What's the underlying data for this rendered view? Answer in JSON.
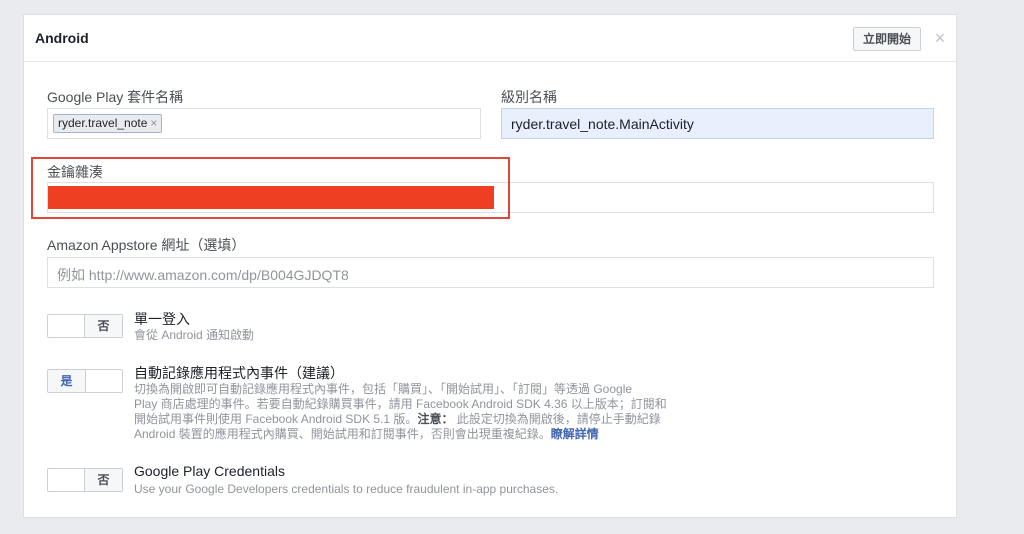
{
  "panel": {
    "title": "Android",
    "start_button": "立即開始",
    "close_glyph": "×"
  },
  "package_name": {
    "label": "Google Play 套件名稱",
    "token": "ryder.travel_note",
    "token_remove": "×"
  },
  "class_name": {
    "label": "級別名稱",
    "value": "ryder.travel_note.MainActivity"
  },
  "key_hash": {
    "label": "金鑰雜湊"
  },
  "amazon": {
    "label": "Amazon Appstore 網址（選填）",
    "placeholder": "例如 http://www.amazon.com/dp/B004GJDQT8"
  },
  "single_sign_on": {
    "toggle_label": "否",
    "title": "單一登入",
    "desc": "會從 Android 通知啟動"
  },
  "auto_log": {
    "toggle_label": "是",
    "title": "自動記錄應用程式內事件（建議）",
    "desc_1": "切換為開啟即可自動記錄應用程式內事件，包括「購買」、「開始試用」、「訂閱」等透過 Google",
    "desc_2": "Play 商店處理的事件。若要自動紀錄購買事件，請用 Facebook Android SDK 4.36 以上版本；訂閱和",
    "desc_3a": "開始試用事件則使用 Facebook Android SDK 5.1 版。",
    "desc_3b": "注意：",
    "desc_3c": " 此設定切換為開啟後，請停止手動紀錄",
    "desc_4": "Android 裝置的應用程式內購買、開始試用和訂閱事件，否則會出現重複紀錄。",
    "learn_more": "瞭解詳情"
  },
  "credentials": {
    "toggle_label": "否",
    "title": "Google Play Credentials",
    "desc": "Use your Google Developers credentials to reduce fraudulent in-app purchases."
  },
  "colors": {
    "background": "#e9ebee",
    "accent": "#4267b2",
    "redaction": "#ef3f23",
    "highlight_border": "#e0453a",
    "input_highlight": "#e8f0fe"
  }
}
